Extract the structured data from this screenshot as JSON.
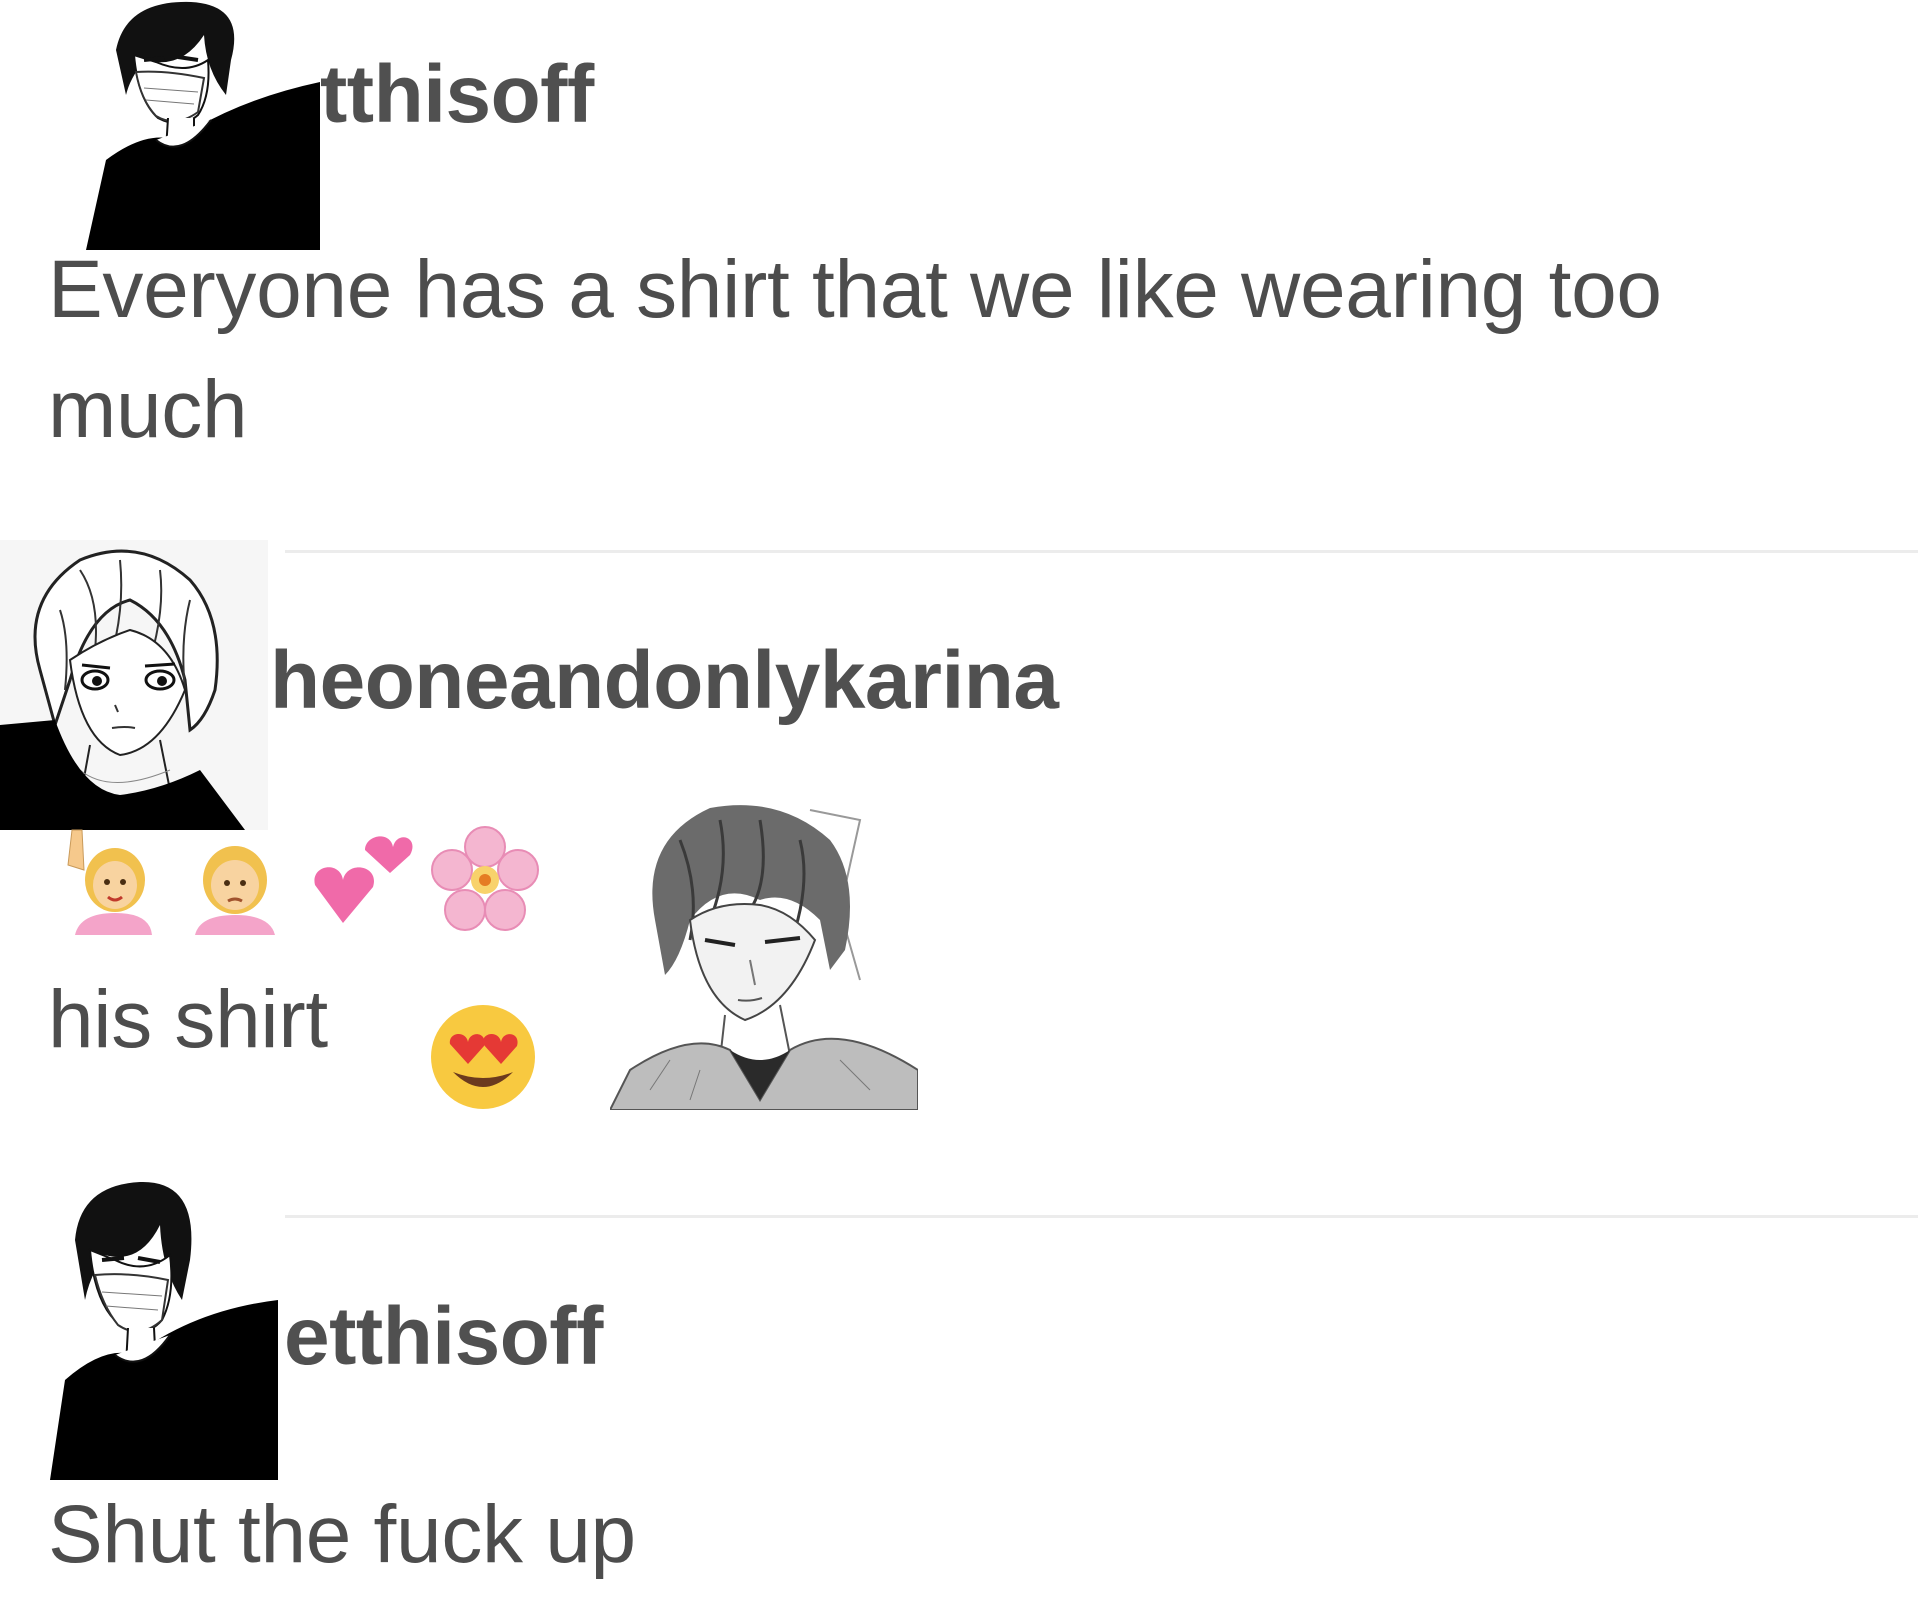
{
  "comments": [
    {
      "username": "tthisoff",
      "text": "Everyone has a shirt that we like wearing too much",
      "avatar_icon": "anime-boy-masked-avatar-icon"
    },
    {
      "username": "heoneandonlykarina",
      "emoji_line": [
        "woman-raising-hand-emoji",
        "woman-pouting-emoji",
        "two-hearts-emoji",
        "cherry-blossom-emoji"
      ],
      "text": "his shirt",
      "text_emoji": "heart-eyes-emoji",
      "avatar_icon": "anime-blonde-boy-avatar-icon",
      "sticker_icon": "anime-boy-sketch-sticker-icon"
    },
    {
      "username": "etthisoff",
      "text": "Shut the fuck up",
      "avatar_icon": "anime-boy-masked-avatar-icon"
    }
  ],
  "colors": {
    "text": "#4d4d4d",
    "divider": "#ececec",
    "background": "#ffffff",
    "heart_pink": "#f06aa9",
    "emoji_skin": "#f6c98c"
  }
}
